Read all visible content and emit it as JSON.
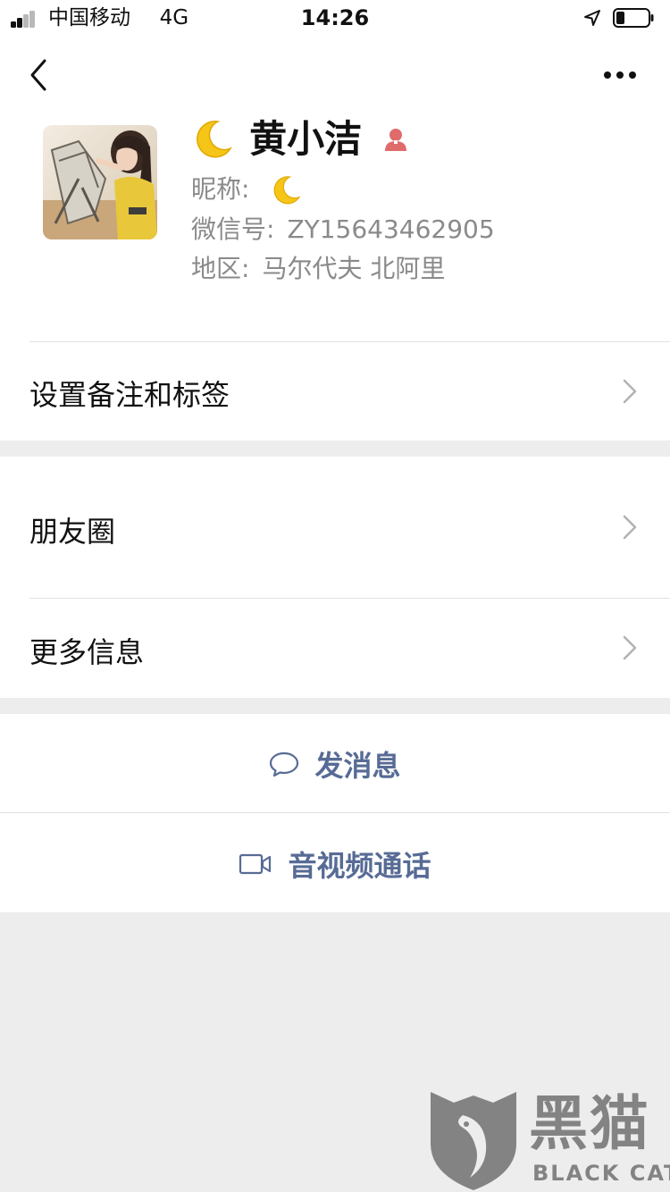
{
  "status_bar": {
    "carrier": "中国移动",
    "network": "4G",
    "time": "14:26",
    "battery_level": 0.25
  },
  "header": {
    "back_icon": "chevron-left-icon",
    "more_icon": "more-dots-icon"
  },
  "profile": {
    "display_name": "黄小洁",
    "name_emoji_icon": "crescent-moon-icon",
    "gender_icon": "female-icon",
    "nickname_label": "昵称:",
    "wechat_id_label": "微信号:",
    "wechat_id": "ZY15643462905",
    "region_label": "地区:",
    "region": "马尔代夫 北阿里"
  },
  "rows": {
    "remark_tags": "设置备注和标签",
    "moments": "朋友圈",
    "more_info": "更多信息"
  },
  "actions": {
    "message": "发消息",
    "video_call": "音视频通话"
  },
  "watermark": {
    "title": "黑猫",
    "subtitle": "BLACK CAT"
  },
  "colors": {
    "link_blue": "#576b95",
    "background": "#ededed",
    "female_pink": "#e06b6b"
  }
}
